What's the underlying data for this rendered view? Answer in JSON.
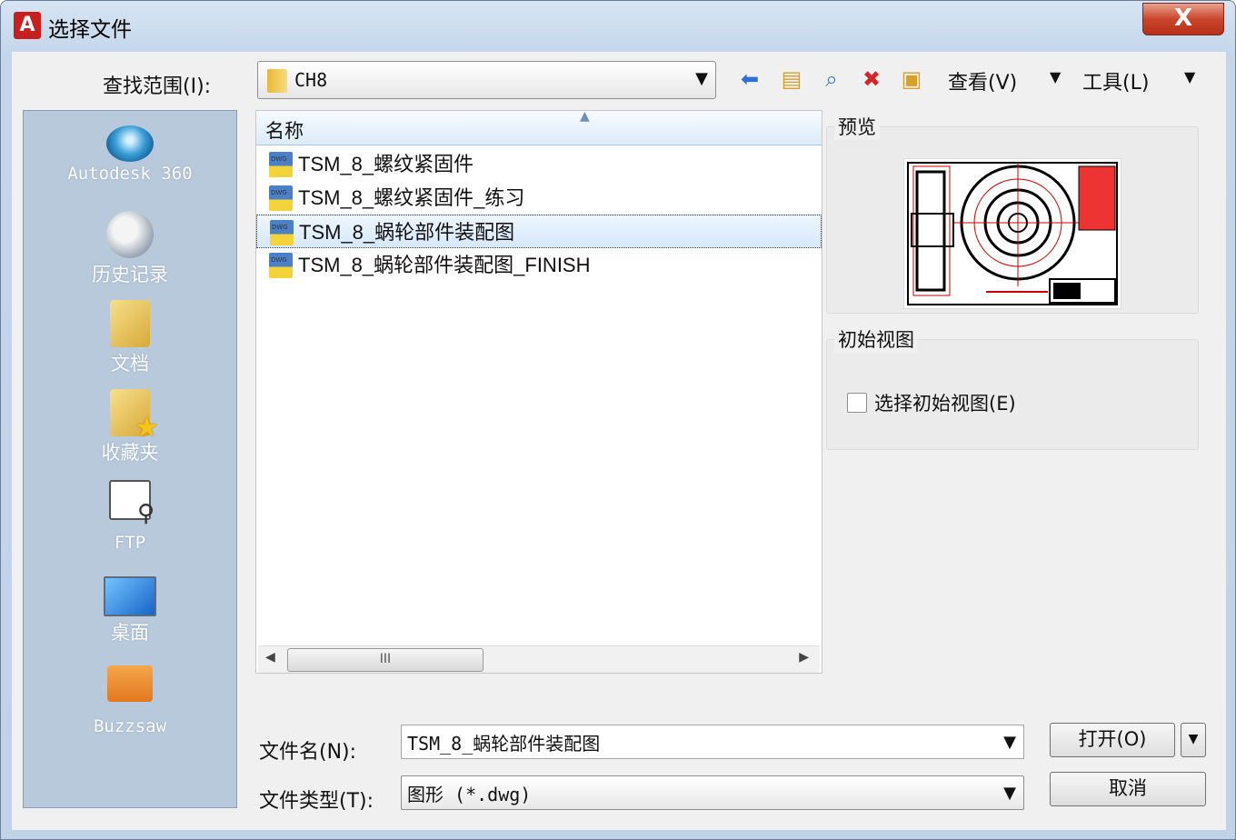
{
  "window": {
    "title": "选择文件",
    "close_label": "X"
  },
  "toolbar": {
    "look_in_label": "查找范围(I):",
    "look_in_value": "CH8",
    "view_label": "查看(V)",
    "tools_label": "工具(L)"
  },
  "places": [
    {
      "label": "Autodesk 360",
      "icon": "cloud-icon"
    },
    {
      "label": "历史记录",
      "icon": "history-icon"
    },
    {
      "label": "文档",
      "icon": "documents-folder-icon"
    },
    {
      "label": "收藏夹",
      "icon": "favorites-folder-icon"
    },
    {
      "label": "FTP",
      "icon": "ftp-icon"
    },
    {
      "label": "桌面",
      "icon": "desktop-icon"
    },
    {
      "label": "Buzzsaw",
      "icon": "buzzsaw-icon"
    }
  ],
  "file_list": {
    "column_name": "名称",
    "files": [
      {
        "name": "TSM_8_螺纹紧固件",
        "selected": false
      },
      {
        "name": "TSM_8_螺纹紧固件_练习",
        "selected": false
      },
      {
        "name": "TSM_8_蜗轮部件装配图",
        "selected": true
      },
      {
        "name": "TSM_8_蜗轮部件装配图_FINISH",
        "selected": false
      }
    ],
    "scroll_thumb": "III"
  },
  "preview": {
    "title": "预览"
  },
  "initial_view": {
    "title": "初始视图",
    "checkbox_label": "选择初始视图(E)",
    "checked": false
  },
  "bottom": {
    "filename_label": "文件名(N):",
    "filename_value": "TSM_8_蜗轮部件装配图",
    "filetype_label": "文件类型(T):",
    "filetype_value": "图形 (*.dwg)",
    "open_label": "打开(O)",
    "cancel_label": "取消"
  },
  "colors": {
    "selection": "#d6e8fb",
    "places_bg": "#b9c9dc",
    "accent_red": "#c81e1e"
  }
}
